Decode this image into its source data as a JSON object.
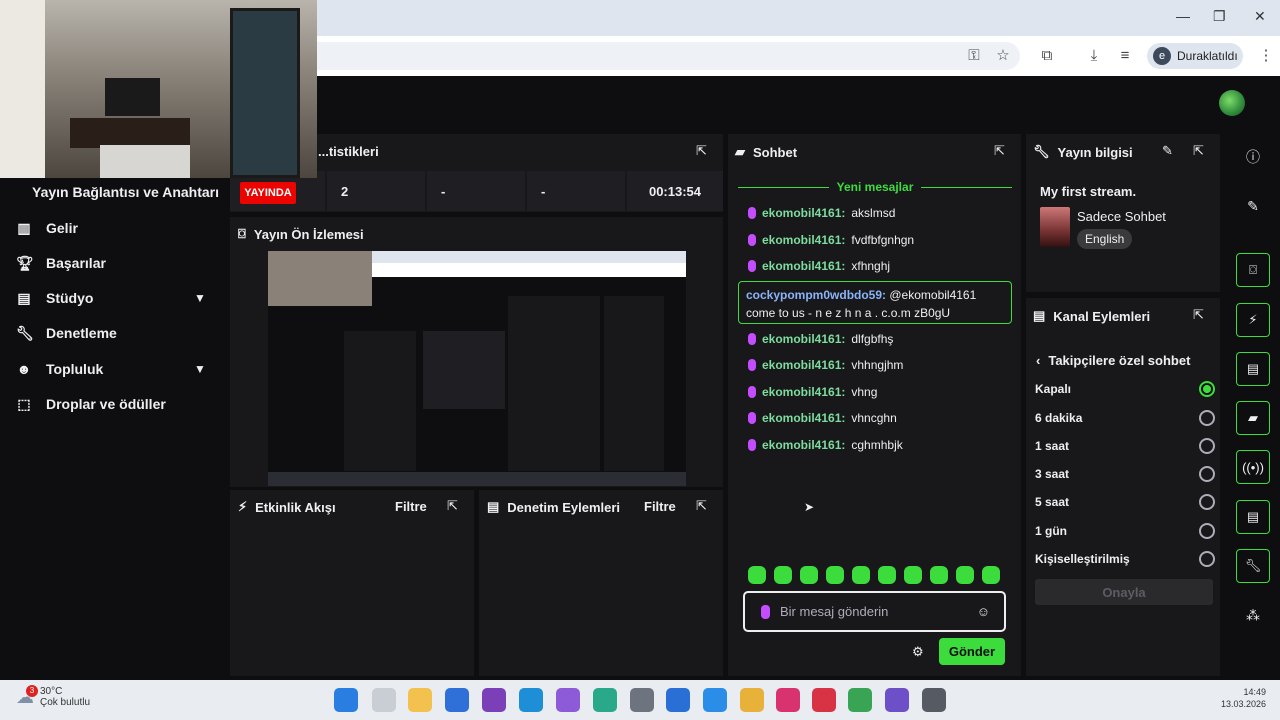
{
  "browser": {
    "profile_initial": "e",
    "profile_label": "Duraklatıldı",
    "window_controls": [
      "—",
      "❐",
      "✕"
    ]
  },
  "nav": {
    "header": "Yayın Bağlantısı ve Anahtarı",
    "items": [
      {
        "label": "Gelir",
        "icon": "revenue-icon"
      },
      {
        "label": "Başarılar",
        "icon": "trophy-icon"
      },
      {
        "label": "Stüdyo",
        "icon": "studio-icon",
        "expandable": true
      },
      {
        "label": "Denetleme",
        "icon": "wrench-icon"
      },
      {
        "label": "Topluluk",
        "icon": "community-icon",
        "expandable": true
      },
      {
        "label": "Droplar ve ödüller",
        "icon": "gift-icon"
      }
    ]
  },
  "stats": {
    "title": "...tistikleri",
    "live": "YAYINDA",
    "viewers": "2",
    "col3": "-",
    "col4": "-",
    "uptime": "00:13:54"
  },
  "preview": {
    "title": "Yayın Ön İzlemesi"
  },
  "activity": {
    "title": "Etkinlik Akışı",
    "filter": "Filtre"
  },
  "moderation": {
    "title": "Denetim Eylemleri",
    "filter": "Filtre"
  },
  "chat": {
    "title": "Sohbet",
    "new_messages": "Yeni mesajlar",
    "messages": [
      {
        "user": "ekomobil4161:",
        "text": "akslmsd"
      },
      {
        "user": "ekomobil4161:",
        "text": "fvdfbfgnhgn"
      },
      {
        "user": "ekomobil4161:",
        "text": "xfhnghj"
      }
    ],
    "highlight": {
      "user": "cockypompm0wdbdo59:",
      "text": "@ekomobil4161 come to us - n e z h n a . c.o.m zB0gU"
    },
    "messages2": [
      {
        "user": "ekomobil4161:",
        "text": "dlfgbfhş"
      },
      {
        "user": "ekomobil4161:",
        "text": "vhhngjhm"
      },
      {
        "user": "ekomobil4161:",
        "text": "vhng"
      },
      {
        "user": "ekomobil4161:",
        "text": "vhncghn"
      },
      {
        "user": "ekomobil4161:",
        "text": "cghmhbjk"
      }
    ],
    "input_placeholder": "Bir mesaj gönderin",
    "send_label": "Gönder"
  },
  "stream_info": {
    "title": "Yayın bilgisi",
    "stream_title": "My first stream.",
    "category": "Sadece Sohbet",
    "language_tag": "English"
  },
  "channel_actions": {
    "title": "Kanal Eylemleri",
    "section": "Takipçilere özel sohbet",
    "options": [
      {
        "label": "Kapalı",
        "selected": true
      },
      {
        "label": "6 dakika",
        "selected": false
      },
      {
        "label": "1 saat",
        "selected": false
      },
      {
        "label": "3 saat",
        "selected": false
      },
      {
        "label": "5 saat",
        "selected": false
      },
      {
        "label": "1 gün",
        "selected": false
      },
      {
        "label": "Kişiselleştirilmiş",
        "selected": false
      }
    ],
    "confirm_label": "Onayla"
  },
  "taskbar": {
    "weather_temp": "30°C",
    "weather_desc": "Çok bulutlu",
    "notif_count": "3",
    "time": "14:49",
    "date": "13.03.2026"
  },
  "colors": {
    "accent": "#3ddc3d",
    "live": "#eb0400",
    "panel": "#18181b",
    "bg": "#0e0e10"
  }
}
